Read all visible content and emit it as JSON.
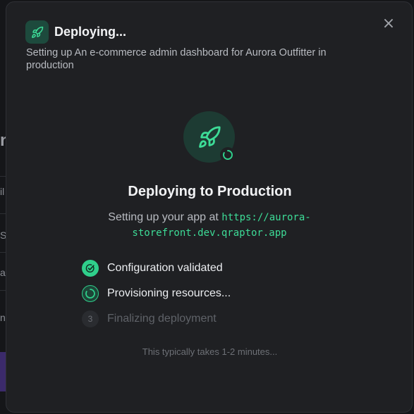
{
  "background": {
    "fragments": [
      "n",
      "il",
      "S",
      "a",
      "n"
    ]
  },
  "modal": {
    "title": "Deploying...",
    "subtitle": "Setting up An e-commerce admin dashboard for Aurora Outfitter in production",
    "close_label": "×",
    "heading": "Deploying to Production",
    "description_prefix": "Setting up your app at ",
    "url": "https://aurora-storefront.dev.qraptor.app",
    "steps": [
      {
        "label": "Configuration validated",
        "status": "done"
      },
      {
        "label": "Provisioning resources...",
        "status": "active"
      },
      {
        "label": "Finalizing deployment",
        "status": "pending",
        "number": "3"
      }
    ],
    "footnote": "This typically takes 1-2 minutes..."
  },
  "colors": {
    "accent": "#2fcf8b",
    "url": "#3ddc97",
    "modal_bg": "#1f2023"
  },
  "icons": [
    "rocket-icon",
    "close-icon",
    "spinner-icon",
    "check-icon"
  ]
}
